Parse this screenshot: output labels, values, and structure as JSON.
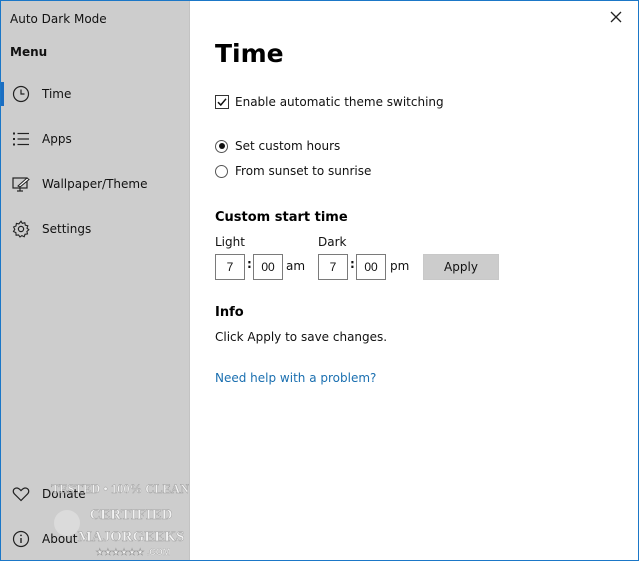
{
  "window": {
    "app_title": "Auto Dark Mode",
    "accent_color": "#1b6ec2",
    "close_icon": "close-icon"
  },
  "sidebar": {
    "menu_title": "Menu",
    "items": [
      {
        "label": "Time",
        "icon": "clock-icon",
        "active": true
      },
      {
        "label": "Apps",
        "icon": "list-icon",
        "active": false
      },
      {
        "label": "Wallpaper/Theme",
        "icon": "wallpaper-theme-icon",
        "active": false
      },
      {
        "label": "Settings",
        "icon": "gear-icon",
        "active": false
      }
    ],
    "bottom_items": [
      {
        "label": "Donate",
        "icon": "heart-icon"
      },
      {
        "label": "About",
        "icon": "info-icon"
      }
    ],
    "watermark": {
      "line1": "TESTED • 100% CLEAN",
      "line2": "CERTIFIED",
      "line3": "MAJORGEEKS",
      "line4": "★★★★★★ .COM"
    }
  },
  "main": {
    "title": "Time",
    "enable_switching": {
      "label": "Enable automatic theme switching",
      "checked": true
    },
    "radio_options": [
      {
        "label": "Set custom hours",
        "checked": true
      },
      {
        "label": "From sunset to sunrise",
        "checked": false
      }
    ],
    "custom_start": {
      "title": "Custom start time",
      "light": {
        "label": "Light",
        "hour": "7",
        "minute": "00",
        "period": "am"
      },
      "dark": {
        "label": "Dark",
        "hour": "7",
        "minute": "00",
        "period": "pm"
      },
      "separator": ":",
      "apply_label": "Apply"
    },
    "info": {
      "title": "Info",
      "text": "Click Apply to save changes."
    },
    "help_link": "Need help with a problem?"
  }
}
